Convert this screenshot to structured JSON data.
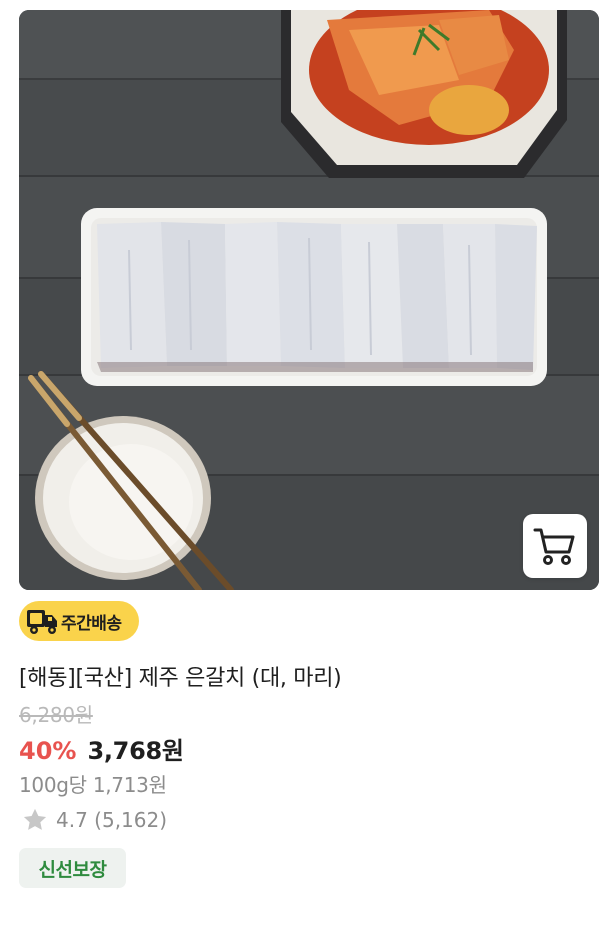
{
  "product": {
    "image_icon": "grilled-fish-product-photo",
    "badge_weekly_delivery": "주간배송",
    "title": "[해동][국산] 제주 은갈치 (대, 마리)",
    "original_price": "6,280원",
    "discount": "40%",
    "sale_price": "3,768원",
    "unit_price": "100g당 1,713원",
    "rating": "4.7 (5,162)",
    "badge_fresh": "신선보장",
    "colors": {
      "discount": "#e8534f",
      "weekly_badge_bg": "#fad34b",
      "fresh_text": "#2e8b3e",
      "fresh_bg": "#eef2ef"
    }
  },
  "icons": {
    "cart": "cart-icon",
    "truck": "delivery-truck-icon",
    "star": "star-icon"
  }
}
